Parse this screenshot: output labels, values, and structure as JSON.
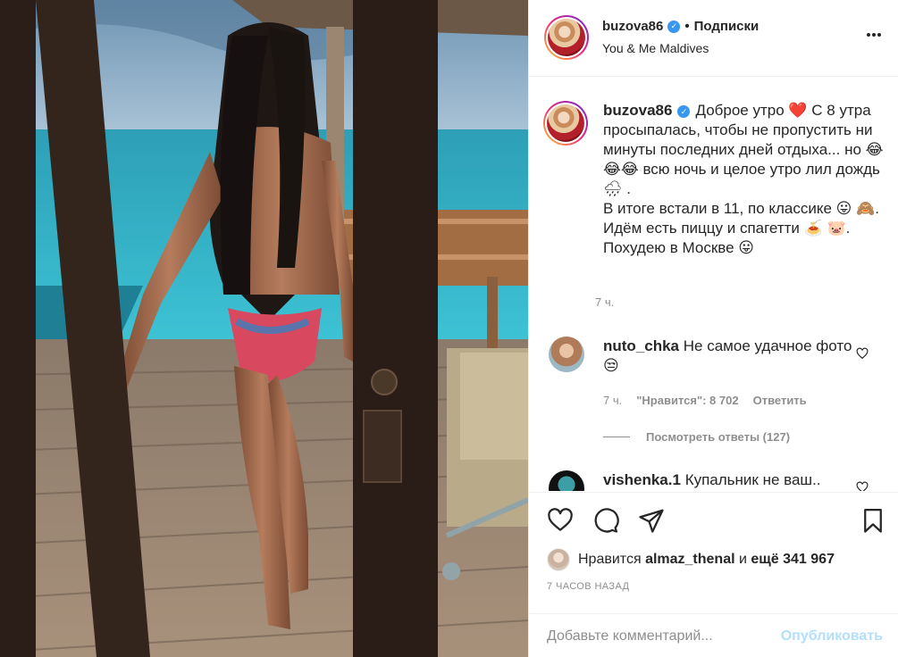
{
  "post": {
    "image_alt": "",
    "header": {
      "username": "buzova86",
      "separator": "•",
      "follow_label": "Подписки",
      "location": "You & Me Maldives",
      "more_icon": "more-horizontal-icon"
    },
    "caption": {
      "username": "buzova86",
      "text": "Доброе утро ❤️ С 8 утра просыпалась, чтобы не пропустить ни минуты последних дней отдыха... но 😂😂😂 всю ночь и целое утро лил дождь 🌧 .\nВ итоге встали в 11, по классике 😛 🙈.\nИдём есть пиццу и спагетти 🍝 🐷.\nПохудею в Москве 😛",
      "time": "7 ч."
    },
    "comments": [
      {
        "username": "nuto_chka",
        "text": "Не самое удачное фото 😒",
        "time": "7 ч.",
        "likes": "\"Нравится\": 8 702",
        "reply_label": "Ответить",
        "view_replies": "Посмотреть ответы (127)"
      },
      {
        "username": "vishenka.1",
        "text": "Купальник не ваш.."
      }
    ],
    "actions": {
      "liked_by_prefix": "Нравится",
      "liked_by_user": "almaz_thenal",
      "liked_by_suffix": "и",
      "liked_by_count": "ещё 341 967",
      "posted_ago": "7 ЧАСОВ НАЗАД"
    },
    "comment_box": {
      "placeholder": "Добавьте комментарий...",
      "publish_label": "Опубликовать"
    }
  },
  "colors": {
    "text": "#262626",
    "muted": "#8e8e8e",
    "verified": "#3897f0",
    "publish_disabled": "#b2dffc",
    "border": "#efefef"
  }
}
